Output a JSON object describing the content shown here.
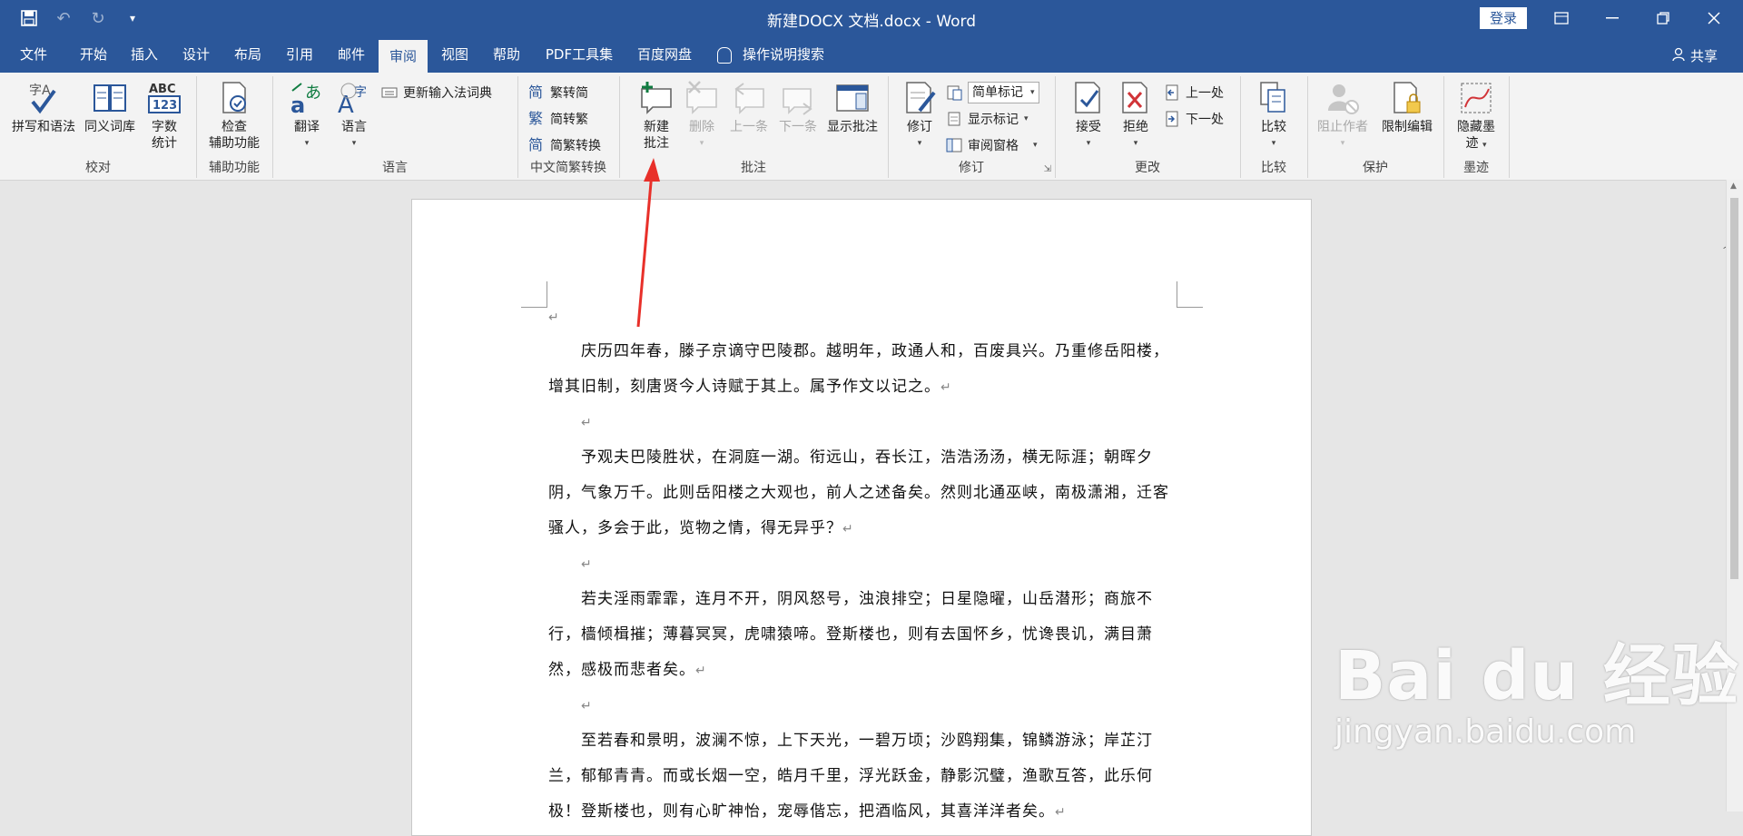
{
  "window": {
    "title": "新建DOCX 文档.docx  -  Word",
    "login": "登录"
  },
  "tabs": [
    "文件",
    "开始",
    "插入",
    "设计",
    "布局",
    "引用",
    "邮件",
    "审阅",
    "视图",
    "帮助",
    "PDF工具集",
    "百度网盘",
    "操作说明搜索"
  ],
  "active_tab": "审阅",
  "share": "共享",
  "ribbon": {
    "proofing": {
      "label": "校对",
      "spell": "拼写和语法",
      "thesaurus": "同义词库",
      "wordcount_1": "字数",
      "wordcount_2": "统计"
    },
    "accessibility": {
      "label": "辅助功能",
      "check_1": "检查",
      "check_2": "辅助功能"
    },
    "language": {
      "label": "语言",
      "translate": "翻译",
      "language": "语言",
      "update_ime": "更新输入法词典"
    },
    "chinese": {
      "label": "中文简繁转换",
      "t2s": "繁转简",
      "s2t": "简转繁",
      "convert": "简繁转换"
    },
    "comments": {
      "label": "批注",
      "new_1": "新建",
      "new_2": "批注",
      "delete": "删除",
      "prev": "上一条",
      "next": "下一条",
      "show": "显示批注"
    },
    "tracking": {
      "label": "修订",
      "track": "修订",
      "markup_select": "简单标记",
      "show_markup": "显示标记",
      "review_pane": "审阅窗格"
    },
    "changes": {
      "label": "更改",
      "accept": "接受",
      "reject": "拒绝",
      "prev": "上一处",
      "next": "下一处"
    },
    "compare": {
      "label": "比较",
      "compare": "比较"
    },
    "protect": {
      "label": "保护",
      "block": "阻止作者",
      "restrict": "限制编辑"
    },
    "ink": {
      "label": "墨迹",
      "hide_1": "隐藏墨",
      "hide_2": "迹"
    }
  },
  "document": {
    "paragraphs": [
      {
        "text": "庆历四年春，滕子京谪守巴陵郡。越明年，政通人和，百废具兴。乃重修岳阳楼，增其旧制，刻唐贤今人诗赋于其上。属予作文以记之。"
      },
      {
        "text": ""
      },
      {
        "text": "予观夫巴陵胜状，在洞庭一湖。衔远山，吞长江，浩浩汤汤，横无际涯；朝晖夕阴，气象万千。此则岳阳楼之大观也，前人之述备矣。然则北通巫峡，南极潇湘，迁客骚人，多会于此，览物之情，得无异乎？"
      },
      {
        "text": ""
      },
      {
        "text": "若夫淫雨霏霏，连月不开，阴风怒号，浊浪排空；日星隐曜，山岳潜形；商旅不行，樯倾楫摧；薄暮冥冥，虎啸猿啼。登斯楼也，则有去国怀乡，忧谗畏讥，满目萧然，感极而悲者矣。"
      },
      {
        "text": ""
      },
      {
        "text": "至若春和景明，波澜不惊，上下天光，一碧万顷；沙鸥翔集，锦鳞游泳；岸芷汀兰，郁郁青青。而或长烟一空，皓月千里，浮光跃金，静影沉璧，渔歌互答，此乐何极！登斯楼也，则有心旷神怡，宠辱偕忘，把酒临风，其喜洋洋者矣。"
      }
    ],
    "para_mark": "↵"
  },
  "watermark": {
    "big": "Bai du 经验",
    "small": "jingyan.baidu.com"
  },
  "colors": {
    "accent": "#2b579a",
    "arrow": "#e8302a"
  }
}
